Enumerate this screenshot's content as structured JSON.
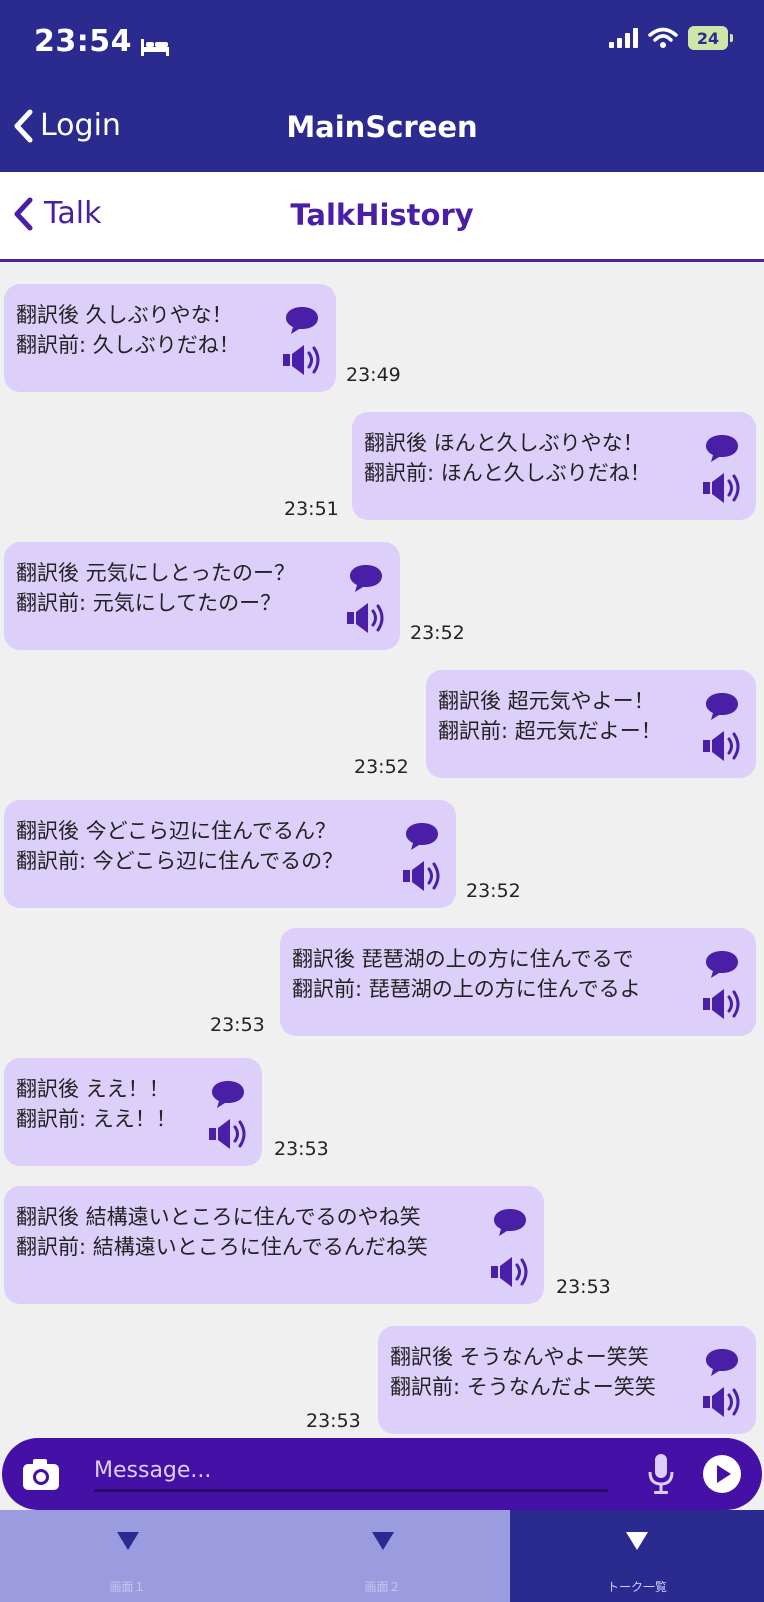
{
  "status_bar": {
    "time": "23:54",
    "battery": "24"
  },
  "nav": {
    "back_label": "Login",
    "title": "MainScreen"
  },
  "subnav": {
    "back_label": "Talk",
    "title": "TalkHistory"
  },
  "messages": [
    {
      "side": "left",
      "after": "翻訳後 久しぶりやな！",
      "before": "翻訳前: 久しぶりだね！",
      "time": "23:49"
    },
    {
      "side": "right",
      "after": "翻訳後 ほんと久しぶりやな！",
      "before": "翻訳前: ほんと久しぶりだね！",
      "time": "23:51"
    },
    {
      "side": "left",
      "after": "翻訳後 元気にしとったのー？",
      "before": "翻訳前: 元気にしてたのー？",
      "time": "23:52"
    },
    {
      "side": "right",
      "after": "翻訳後 超元気やよー！",
      "before": "翻訳前: 超元気だよー！",
      "time": "23:52"
    },
    {
      "side": "left",
      "after": "翻訳後 今どこら辺に住んでるん？",
      "before": "翻訳前: 今どこら辺に住んでるの？",
      "time": "23:52"
    },
    {
      "side": "right",
      "after": "翻訳後 琵琶湖の上の方に住んでるで",
      "before": "翻訳前: 琵琶湖の上の方に住んでるよ",
      "time": "23:53"
    },
    {
      "side": "left",
      "after": "翻訳後 ええ！！",
      "before": "翻訳前: ええ！！",
      "time": "23:53"
    },
    {
      "side": "left",
      "after": "翻訳後 結構遠いところに住んでるのやね笑",
      "before": "翻訳前: 結構遠いところに住んでるんだね笑",
      "time": "23:53"
    },
    {
      "side": "right",
      "after": "翻訳後 そうなんやよー笑笑",
      "before": "翻訳前: そうなんだよー笑笑",
      "time": "23:53"
    }
  ],
  "composer": {
    "placeholder": "Message..."
  },
  "tabs": [
    {
      "label": "画面１",
      "active": false
    },
    {
      "label": "画面２",
      "active": false
    },
    {
      "label": "トーク一覧",
      "active": true
    }
  ],
  "colors": {
    "header": "#2b2a8f",
    "accent": "#4a1fa8",
    "bubble": "#dcd0fb",
    "composer": "#4410a6",
    "tab_inactive": "#9b9ce0"
  },
  "icons": [
    "bed-icon",
    "signal-icon",
    "wifi-icon",
    "battery-icon",
    "chevron-left-icon",
    "chat-bubble-icon",
    "speaker-icon",
    "camera-icon",
    "microphone-icon",
    "send-icon",
    "triangle-down-icon"
  ]
}
